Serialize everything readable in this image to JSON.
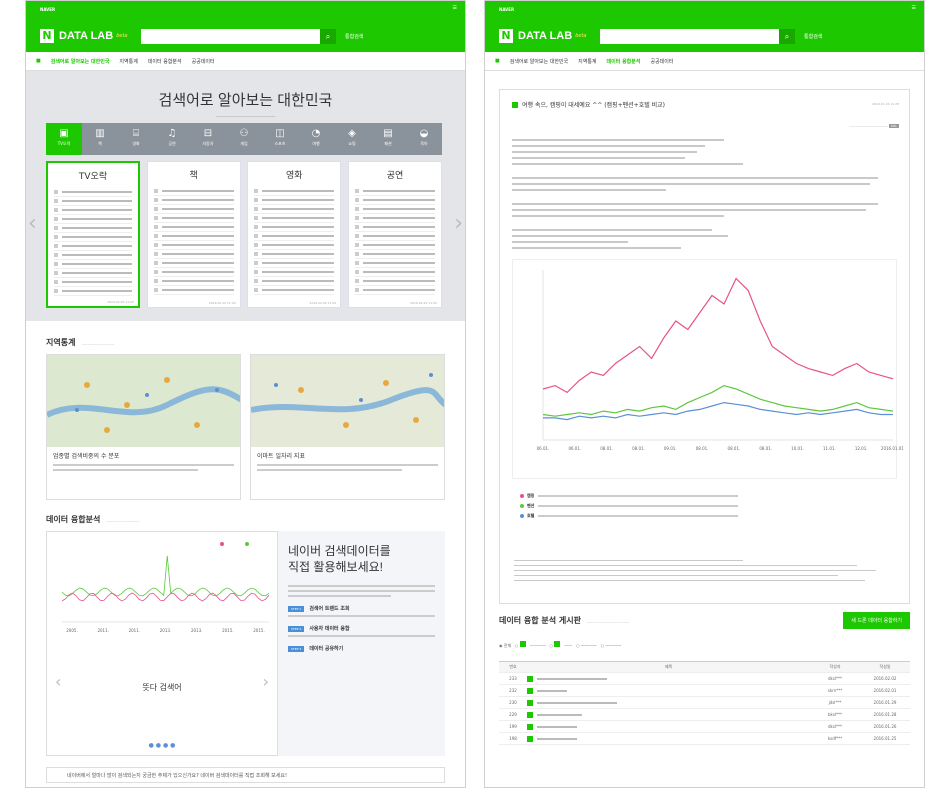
{
  "brand": {
    "name": "DATA LAB",
    "beta": "beta",
    "search_button": "통합검색"
  },
  "nav": [
    "검색어로 알아보는 대한민국",
    "지역통계",
    "데이터 융합분석",
    "공공데이터"
  ],
  "left": {
    "hero_title": "검색어로 알아보는 대한민국",
    "cats": [
      "TV오락",
      "책",
      "영화",
      "공연",
      "자동차",
      "게임",
      "스포츠",
      "여행",
      "쇼핑",
      "패션",
      "육아"
    ],
    "cards": [
      {
        "title": "TV오락",
        "date": "2016.02.29 11:00"
      },
      {
        "title": "책",
        "date": "2016.02.29 11:00"
      },
      {
        "title": "영화",
        "date": "2016.02.29 11:00"
      },
      {
        "title": "공연",
        "date": "2016.02.29 11:00"
      }
    ],
    "region_title": "지역통계",
    "map1_title": "업종별 검색비중의 수 분포",
    "map2_title": "이마트 일자리 지표",
    "fuse_title": "데이터 융합분석",
    "fuse_heading_1": "네이버 검색데이터를",
    "fuse_heading_2": "직접 활용해보세요!",
    "tags": [
      "STEP 1",
      "STEP 2",
      "STEP 3"
    ],
    "features": [
      "검색어 트렌드 조회",
      "사용자 데이터 융합",
      "데이터 공유하기"
    ],
    "hot_label": "뜻다 검색어",
    "years": [
      "2005.",
      "2011.",
      "2011.",
      "2013.",
      "2013.",
      "2015.",
      "2015."
    ],
    "faq": "네이버에서 얼마나 많이 검색되는지 궁금한 주제가 있으신가요? 네이버 검색데이터를 직접 조회해 보세요!"
  },
  "right": {
    "post_title": "여행 속으, 캠핑이 대세예요 ^^ (캠핑+펜션+호텔 비교)",
    "post_date": "2016.01.15 11:28",
    "x_labels": [
      "06.01.",
      "06.01.",
      "08.01.",
      "08.01.",
      "09.01.",
      "08.01.",
      "08.01.",
      "08.01.",
      "10.01.",
      "11.01.",
      "12.01.",
      "2016.01.01."
    ],
    "legend": [
      "캠핑",
      "펜션",
      "호텔"
    ],
    "board_title": "데이터 융합 분석 게시판",
    "board_button": "새 드론 데이터 융합하기",
    "cols": [
      "번호",
      "제목",
      "작성자",
      "작성일"
    ],
    "rows": [
      {
        "n": "233",
        "w": "dksl***",
        "d": "2016.02.02"
      },
      {
        "n": "232",
        "w": "skrn***",
        "d": "2016.02.01"
      },
      {
        "n": "230",
        "w": "jdsl***",
        "d": "2016.01.29"
      },
      {
        "n": "229",
        "w": "bksl***",
        "d": "2016.01.28"
      },
      {
        "n": "199",
        "w": "dksl***",
        "d": "2016.01.26"
      },
      {
        "n": "198",
        "w": "ksdf***",
        "d": "2016.01.25"
      }
    ]
  },
  "colors": {
    "brand_green": "#1ec800",
    "pink": "#e8528c",
    "green_line": "#5cc83c",
    "blue_line": "#5b8fd8"
  }
}
